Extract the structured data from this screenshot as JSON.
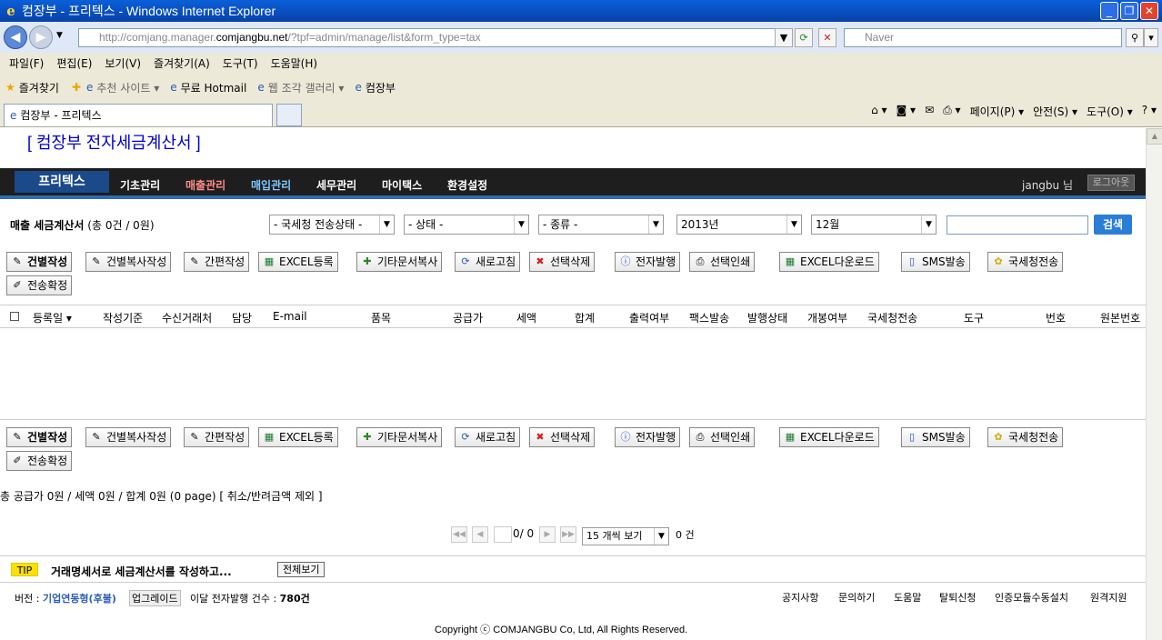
{
  "window": {
    "title": "컴장부 - 프리텍스 - Windows Internet Explorer"
  },
  "browser": {
    "address_prefix": "http://comjang.manager.",
    "address_host": "comjangbu.net",
    "address_suffix": "/?tpf=admin/manage/list&form_type=tax",
    "search_placeholder": "Naver",
    "menu": [
      "파일(F)",
      "편집(E)",
      "보기(V)",
      "즐겨찾기(A)",
      "도구(T)",
      "도움말(H)"
    ],
    "favorites_label": "즐겨찾기",
    "favorites": [
      "추천 사이트 ▾",
      "무료 Hotmail",
      "웹 조각 갤러리 ▾",
      "컴장부"
    ],
    "tab_label": "컴장부 - 프리텍스",
    "tools": [
      "페이지(P) ▾",
      "안전(S) ▾",
      "도구(O) ▾"
    ]
  },
  "page": {
    "brand": "[ 컴장부 전자세금계산서 ]",
    "logo": "프리텍스",
    "nav": [
      "기초관리",
      "매출관리",
      "매입관리",
      "세무관리",
      "마이택스",
      "환경설정"
    ],
    "user": "jangbu 님",
    "logout": "로그아웃",
    "section_title": "매출 세금계산서",
    "section_count": "(총 0건 / 0원)",
    "filters": [
      "- 국세청 전송상태 -",
      "- 상태 -",
      "- 종류 -",
      "2013년",
      "12월"
    ],
    "search_button": "검색",
    "buttons": [
      "건별작성",
      "건별복사작성",
      "간편작성",
      "EXCEL등록",
      "기타문서복사",
      "새로고침",
      "선택삭제",
      "전자발행",
      "선택인쇄",
      "EXCEL다운로드",
      "SMS발송",
      "국세청전송",
      "전송확정"
    ],
    "columns": [
      "등록일 ▾",
      "작성기준",
      "수신거래처",
      "담당",
      "E-mail",
      "품목",
      "공급가",
      "세액",
      "합계",
      "출력여부",
      "팩스발송",
      "발행상태",
      "개봉여부",
      "국세청전송",
      "도구",
      "번호",
      "원본번호"
    ],
    "summary": "총 공급가 0원 / 세액 0원 / 합계 0원 (0 page)   [ 취소/반려금액 제외 ]",
    "pager_text": "0/ 0",
    "page_size": "15 개씩 보기",
    "total": "0 건",
    "tip_label": "TIP",
    "tip_text": "거래명세서로 세금계산서를 작성하고...",
    "tip_button": "전체보기",
    "footer_version_label": "버전 : ",
    "footer_version": "기업연동형(후불)",
    "footer_upgrade": "업그레이드",
    "footer_monthly": "이달 전자발행 건수 : ",
    "footer_count": "780건",
    "footer_links": [
      "공지사항",
      "문의하기",
      "도움말",
      "탈퇴신청",
      "인증모듈수동설치",
      "원격지원"
    ],
    "copyright": "Copyright ⓒ COMJANGBU Co, Ltd, All Rights Reserved."
  },
  "colors": {
    "nav_active": "#ff8a8a",
    "nav_blue": "#7ec8ff",
    "accent": "#2b7ed6"
  }
}
